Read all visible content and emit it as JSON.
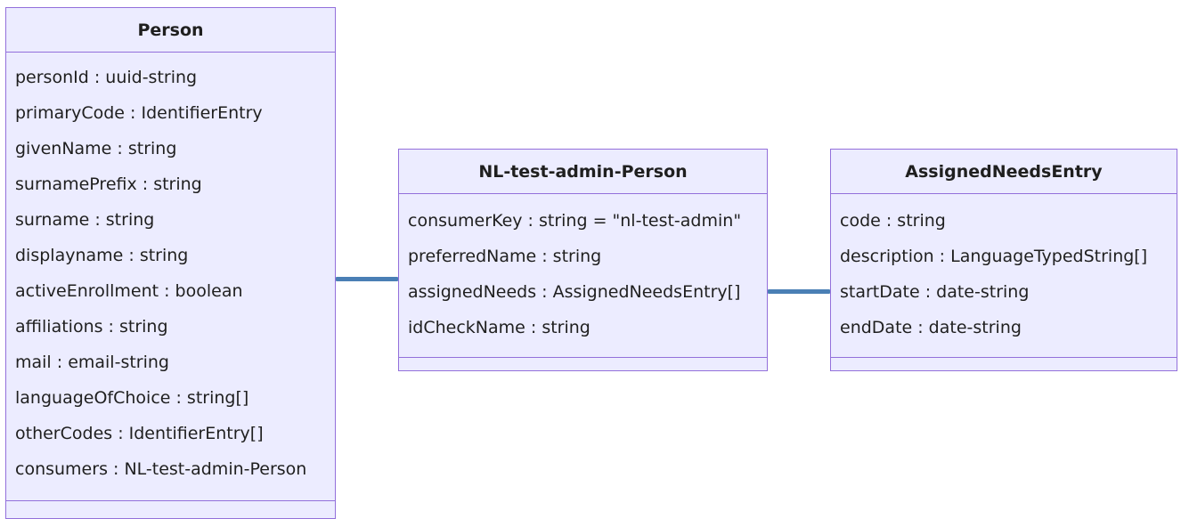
{
  "classes": [
    {
      "id": "person",
      "title": "Person",
      "attributes": [
        "personId : uuid-string",
        "primaryCode : IdentifierEntry",
        "givenName : string",
        "surnamePrefix : string",
        "surname : string",
        "displayname : string",
        "activeEnrollment : boolean",
        "affiliations : string",
        "mail : email-string",
        "languageOfChoice : string[]",
        "otherCodes : IdentifierEntry[]",
        "consumers : NL-test-admin-Person"
      ]
    },
    {
      "id": "nl",
      "title": "NL-test-admin-Person",
      "attributes": [
        "consumerKey : string = \"nl-test-admin\"",
        "preferredName : string",
        "assignedNeeds : AssignedNeedsEntry[]",
        "idCheckName : string"
      ]
    },
    {
      "id": "ane",
      "title": "AssignedNeedsEntry",
      "attributes": [
        "code : string",
        "description : LanguageTypedString[]",
        "startDate : date-string",
        "endDate : date-string"
      ]
    }
  ],
  "colors": {
    "class_fill": "#ececff",
    "class_border": "#9370db",
    "connector": "#4a7fb5"
  }
}
